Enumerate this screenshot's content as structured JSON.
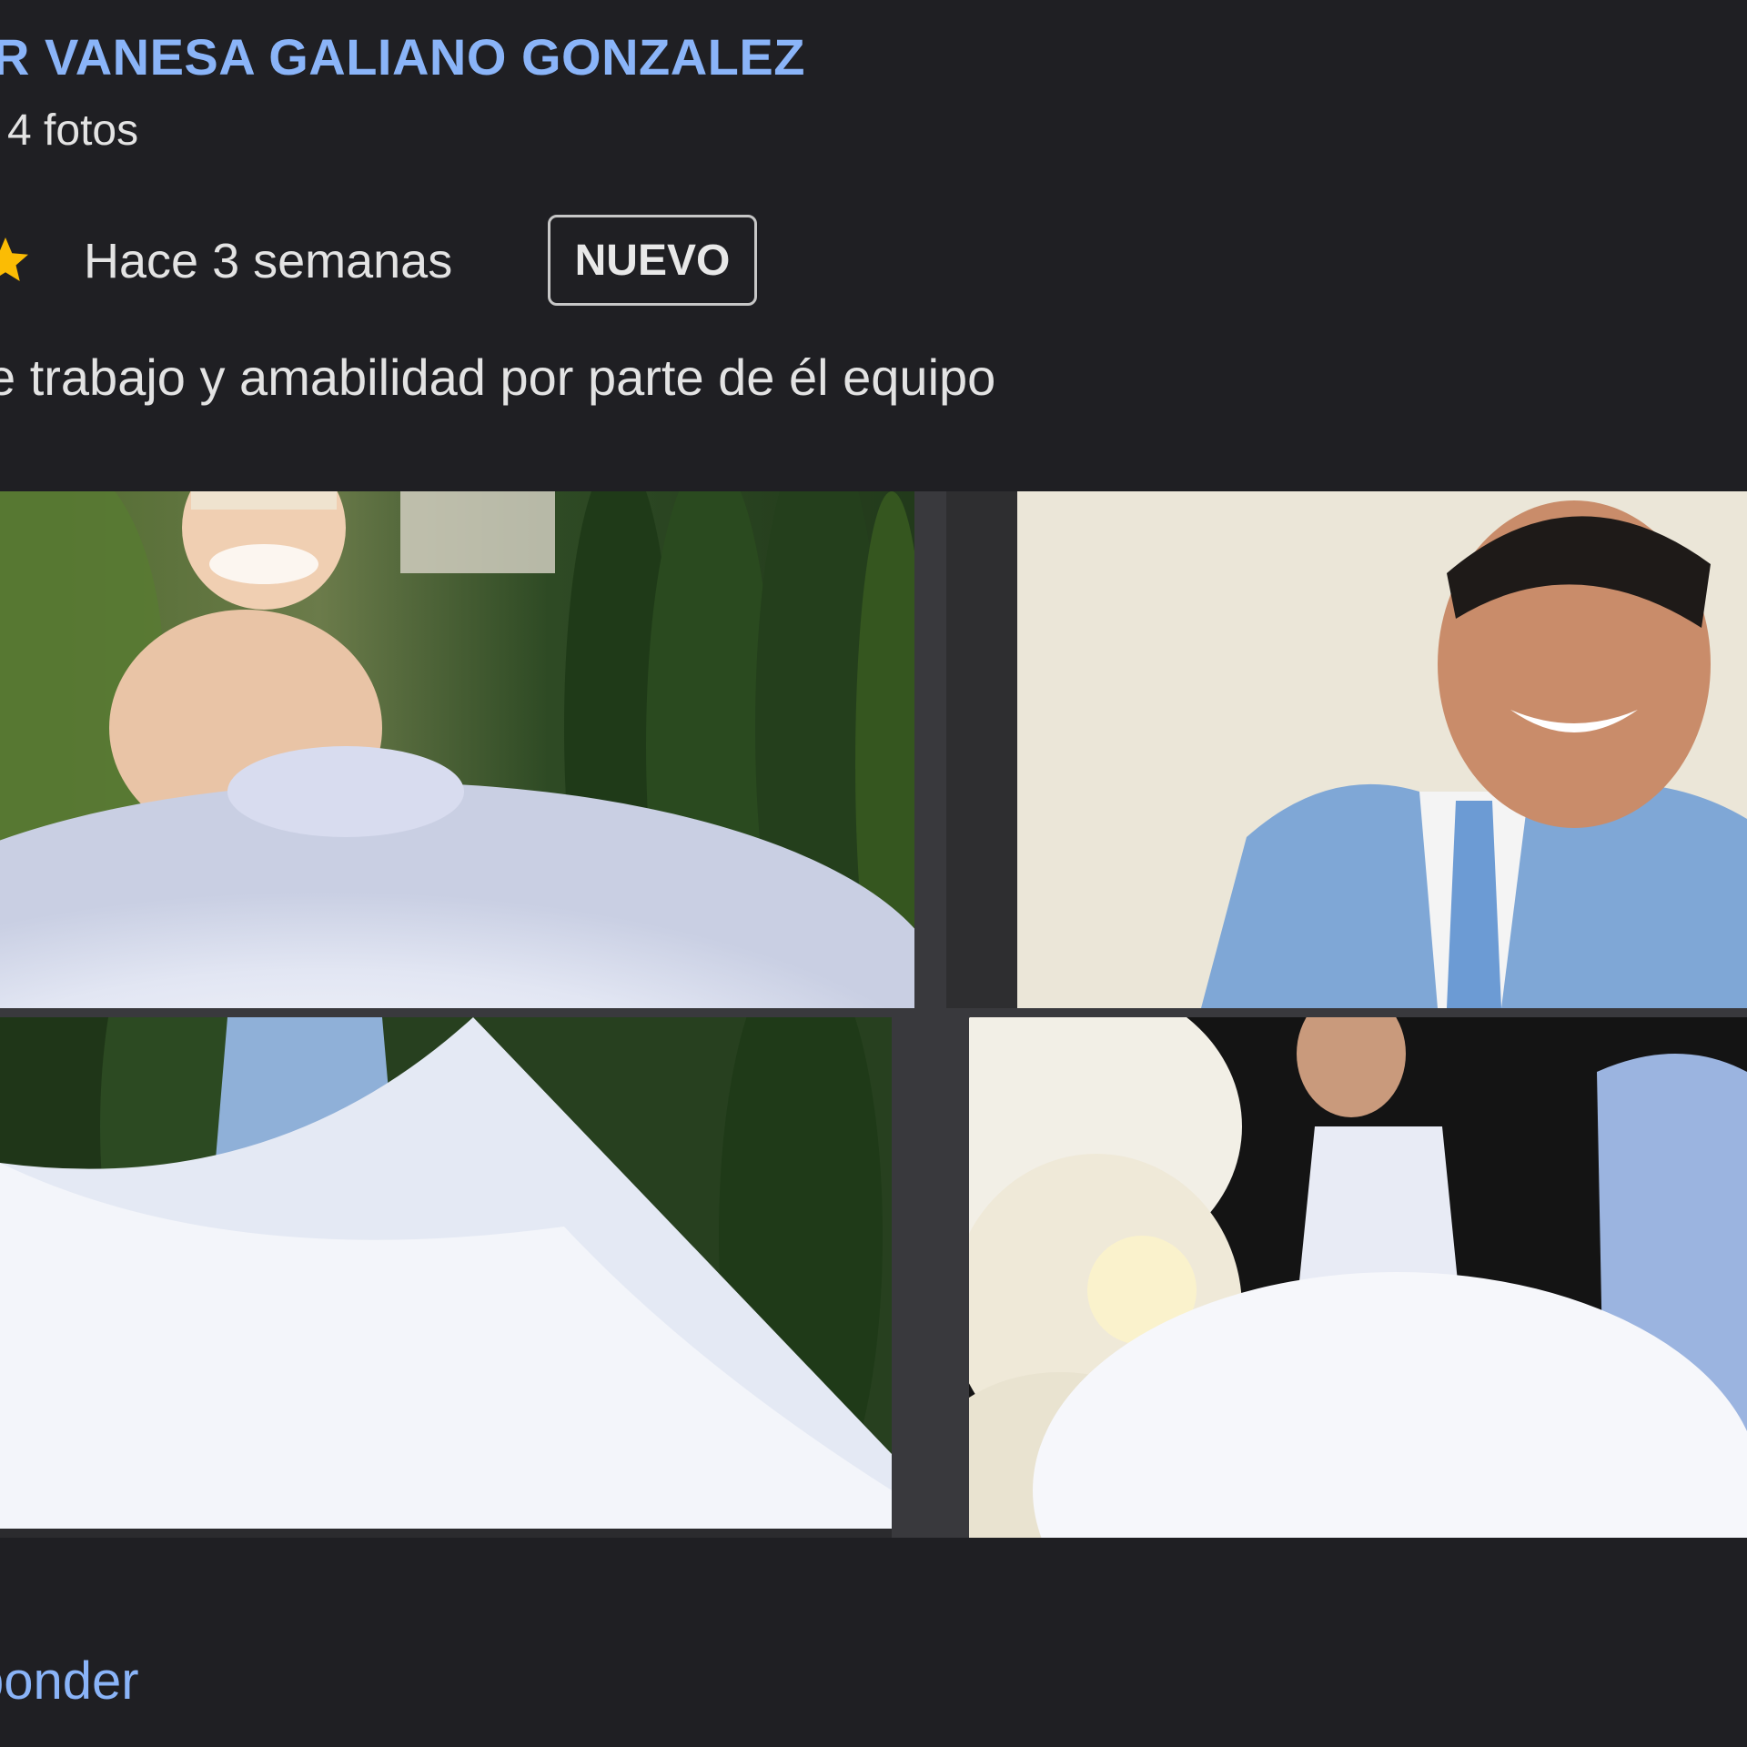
{
  "review": {
    "reviewer_name": "R VANESA GALIANO GONZALEZ",
    "photo_count": "4 fotos",
    "date": "Hace 3 semanas",
    "badge": "NUEVO",
    "text": "e trabajo y amabilidad por parte de él equipo",
    "star_icon": "star-icon",
    "star_color": "#fbbc04"
  },
  "photos": [
    {
      "name": "photo-bride-smiling",
      "alt": "Novia sonriendo con vestido blanco junto a arbustos"
    },
    {
      "name": "photo-man-blue-suit",
      "alt": "Hombre sonriendo con traje azul claro"
    },
    {
      "name": "photo-wedding-veil",
      "alt": "Velo de novia ondeando junto a hombre de traje azul"
    },
    {
      "name": "photo-couple-flowers",
      "alt": "Pareja posando junto a flores blancas"
    }
  ],
  "actions": {
    "reply_label": "ponder"
  },
  "colors": {
    "background": "#1f1f23",
    "link": "#8ab4f8",
    "text": "#e3e3e3"
  }
}
